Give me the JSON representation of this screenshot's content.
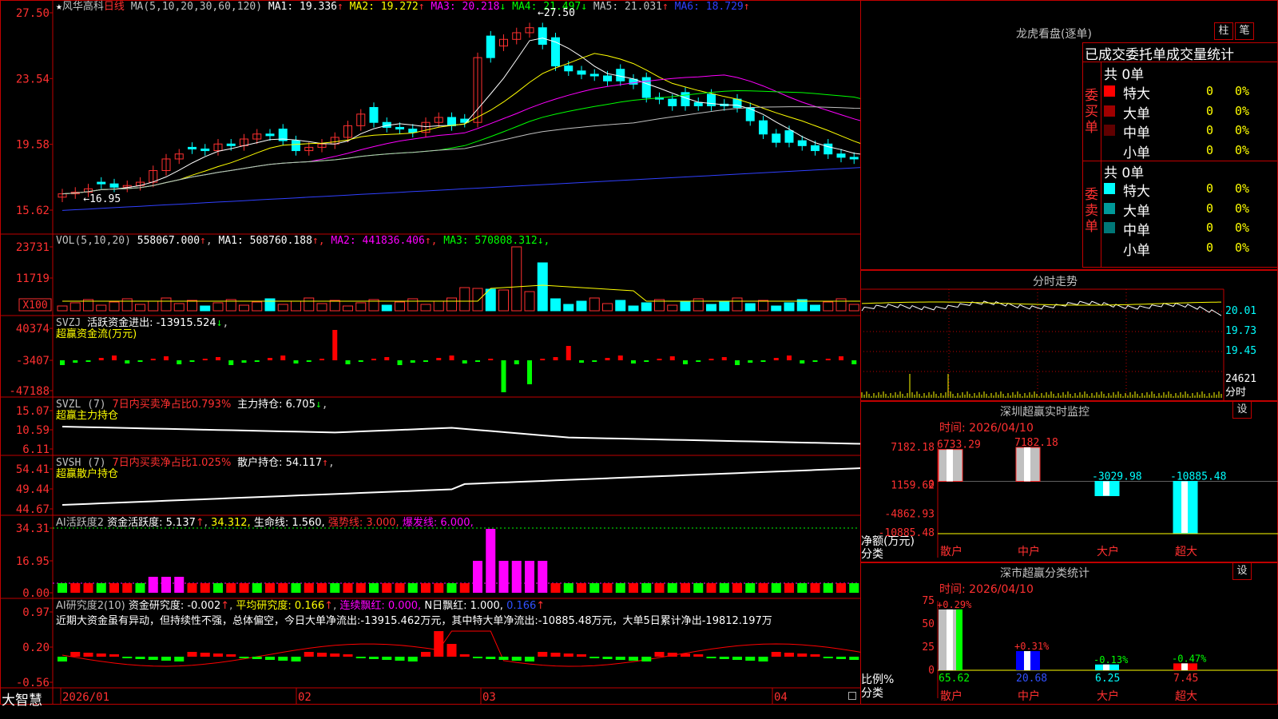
{
  "app_brand": "大智慧",
  "colors": {
    "up": "#ff3030",
    "down": "#00ffff",
    "ma1": "#ffffff",
    "ma2": "#ffff00",
    "ma3": "#ff00ff",
    "ma4": "#00ff00",
    "ma5": "#c0c0c0",
    "ma6": "#0000ff",
    "grid": "#a00000"
  },
  "main_chart": {
    "stock_name": "风华高科",
    "period": "日线",
    "ma_params": "MA(5,10,20,30,60,120)",
    "ma_values": [
      {
        "label": "MA1: 19.336",
        "arrow": "↑",
        "color": "#ffffff"
      },
      {
        "label": "MA2: 19.272",
        "arrow": "↑",
        "color": "#ffff00"
      },
      {
        "label": "MA3: 20.218",
        "arrow": "↓",
        "color": "#ff00ff"
      },
      {
        "label": "MA4: 21.497",
        "arrow": "↓",
        "color": "#00ff00"
      },
      {
        "label": "MA5: 21.031",
        "arrow": "↑",
        "color": "#c0c0c0"
      },
      {
        "label": "MA6: 18.729",
        "arrow": "↑",
        "color": "#3040ff"
      }
    ],
    "y_ticks": [
      "27.50",
      "23.54",
      "19.58",
      "15.62"
    ],
    "y_tick_values": [
      27.5,
      23.54,
      19.58,
      15.62
    ],
    "high_marker": "27.50",
    "low_marker": "16.95",
    "y_range": [
      15.4,
      27.6
    ]
  },
  "volume": {
    "title": "VOL(5,10,20)",
    "value": "558067.000",
    "value_arrow": "↑",
    "mas": [
      {
        "label": "MA1: 508760.188",
        "arrow": "↑",
        "color": "#ffffff"
      },
      {
        "label": "MA2: 441836.406",
        "arrow": "↑",
        "color": "#ff00ff"
      },
      {
        "label": "MA3: 570808.312",
        "arrow": "↓",
        "color": "#00ff00"
      }
    ],
    "y_ticks": [
      "23731",
      "11719"
    ],
    "unit": "X100"
  },
  "svzj": {
    "title": "SVZJ",
    "line1": "活跃资金进出: -13915.524",
    "line1_arrow": "↓",
    "subtitle": "超赢资金流(万元)",
    "y_ticks": [
      "40374",
      "-3407",
      "-47188"
    ]
  },
  "svzl": {
    "title": "SVZL (7)",
    "t1": "7日内买卖净占比0.793%",
    "t2": "主力持仓: 6.705",
    "t2_arrow": "↓",
    "subtitle": "超赢主力持仓",
    "y_ticks": [
      "15.07",
      "10.59",
      "6.11"
    ]
  },
  "svsh": {
    "title": "SVSH (7)",
    "t1": "7日内买卖净占比1.025%",
    "t2": "散户持仓: 54.117",
    "t2_arrow": "↑",
    "subtitle": "超赢散户持仓",
    "y_ticks": [
      "54.41",
      "49.44",
      "44.67"
    ]
  },
  "ai_active": {
    "title": "AI活跃度2",
    "t1": "资金活跃度: 5.137",
    "t1_arrow": "↑",
    "t2": "34.312,",
    "t3": "生命线: 1.560,",
    "t4": "强势线: 3.000,",
    "t5": "爆发线: 6.000,",
    "y_ticks": [
      "34.31",
      "16.95",
      "0.00"
    ]
  },
  "ai_research": {
    "title": "AI研究度2(10)",
    "t1": "资金研究度: -0.002",
    "t1_arrow": "↑",
    "t2": "平均研究度: 0.166",
    "t2_arrow": "↑",
    "t3": "连续飘红: 0.000,",
    "t4": "N日飘红: 1.000,",
    "t5": "0.166",
    "t5_arrow": "↑",
    "comment": "近期大资金虽有异动，但持续性不强，总体偏空，今日大单净流出:-13915.462万元，其中特大单净流出:-10885.48万元，大单5日累计净出-19812.197万",
    "y_ticks": [
      "0.97",
      "0.20",
      "-0.56"
    ]
  },
  "x_axis": {
    "labels": [
      "2026/01",
      "02",
      "03",
      "04"
    ]
  },
  "lhb": {
    "title": "龙虎看盘(逐单)",
    "btn1": "柱",
    "btn2": "笔",
    "subtitle": "已成交委托单成交量统计",
    "buy_label": "委买单",
    "sell_label": "委卖单",
    "buy_total": "共 0单",
    "sell_total": "共 0单",
    "buy_rows": [
      {
        "name": "特大",
        "count": "0",
        "pct": "0%",
        "color": "#ff0000"
      },
      {
        "name": "大单",
        "count": "0",
        "pct": "0%",
        "color": "#a00000"
      },
      {
        "name": "中单",
        "count": "0",
        "pct": "0%",
        "color": "#600000"
      },
      {
        "name": "小单",
        "count": "0",
        "pct": "0%",
        "color": "#000000"
      }
    ],
    "sell_rows": [
      {
        "name": "特大",
        "count": "0",
        "pct": "0%",
        "color": "#00ffff"
      },
      {
        "name": "大单",
        "count": "0",
        "pct": "0%",
        "color": "#009999"
      },
      {
        "name": "中单",
        "count": "0",
        "pct": "0%",
        "color": "#007777"
      },
      {
        "name": "小单",
        "count": "0",
        "pct": "0%",
        "color": "#000000"
      }
    ]
  },
  "intraday": {
    "title": "分时走势",
    "y_ticks": [
      "20.01",
      "19.73",
      "19.45"
    ],
    "vol_tick": "24621",
    "unit_label": "分时"
  },
  "sz_monitor": {
    "title": "深圳超赢实时监控",
    "btn": "设",
    "time": "时间: 2026/04/10",
    "y_ticks": [
      "7182.18",
      "1159.62",
      "0",
      "-4862.93",
      "-10885.48"
    ],
    "ylabel": "净额(万元)",
    "xlabel": "分类",
    "chart_data": {
      "type": "bar",
      "categories": [
        "散户",
        "中户",
        "大户",
        "超大"
      ],
      "values": [
        6733.29,
        7182.18,
        -3029.98,
        -10885.48
      ],
      "value_labels": [
        "6733.29",
        "7182.18",
        "-3029.98",
        "-10885.48"
      ],
      "ylim": [
        -10885.48,
        7182.18
      ]
    }
  },
  "sz_class": {
    "title": "深市超赢分类统计",
    "btn": "设",
    "time": "时间: 2026/04/10",
    "y_ticks": [
      "75",
      "50",
      "25",
      "0"
    ],
    "ylabel": "比例%",
    "xlabel": "分类",
    "chart_data": {
      "type": "bar",
      "categories": [
        "散户",
        "中户",
        "大户",
        "超大"
      ],
      "values": [
        65.62,
        20.68,
        6.25,
        7.45
      ],
      "value_labels": [
        "65.62",
        "20.68",
        "6.25",
        "7.45"
      ],
      "change_labels": [
        "+0.29%",
        "+0.31%",
        "-0.13%",
        "-0.47%"
      ],
      "ylim": [
        0,
        75
      ]
    }
  }
}
